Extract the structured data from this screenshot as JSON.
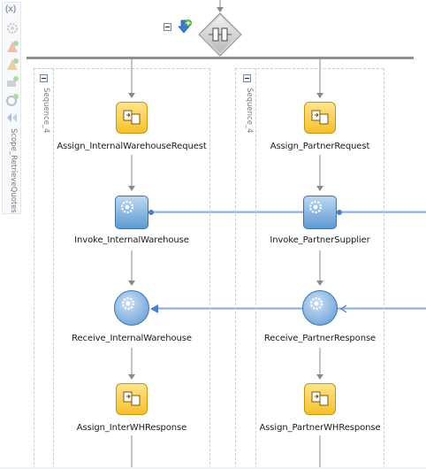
{
  "toolbar": {
    "variables_icon_text": "(x)",
    "scope_label": "Scope_RetrieveQuotes"
  },
  "flow": {
    "sequence_left": "Sequence_4",
    "sequence_right": "Sequence_4",
    "left": {
      "assign_request": "Assign_InternalWarehouseRequest",
      "invoke": "Invoke_InternalWarehouse",
      "receive": "Receive_InternalWarehouse",
      "assign_response": "Assign_InterWHResponse"
    },
    "right": {
      "assign_request": "Assign_PartnerRequest",
      "invoke": "Invoke_PartnerSupplier",
      "receive": "Receive_PartnerResponse",
      "assign_response": "Assign_PartnerWHResponse"
    }
  },
  "colors": {
    "assign_fill": "#f6c12e",
    "invoke_fill": "#5e9ad2",
    "partner_link": "#8fb3e6",
    "connector": "#8a8a8a"
  }
}
